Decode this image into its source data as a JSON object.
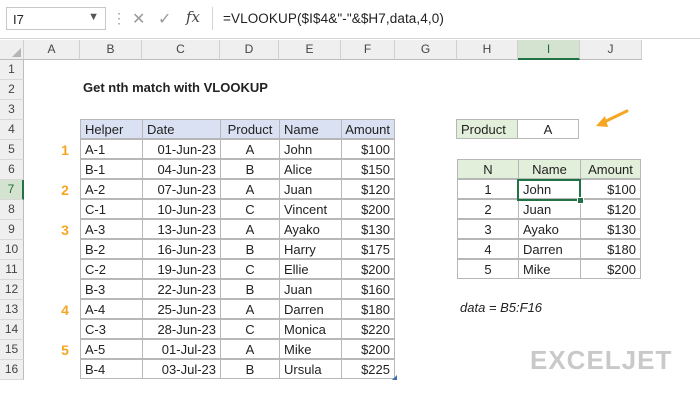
{
  "formula_bar": {
    "name_box": "I7",
    "name_box_icon": "chevron-down-icon",
    "fx_label": "fx",
    "formula": "=VLOOKUP($I$4&\"-\"&$H7,data,4,0)"
  },
  "columns": [
    "A",
    "B",
    "C",
    "D",
    "E",
    "F",
    "G",
    "H",
    "I",
    "J"
  ],
  "selected_column": "I",
  "rows": [
    "1",
    "2",
    "3",
    "4",
    "5",
    "6",
    "7",
    "8",
    "9",
    "10",
    "11",
    "12",
    "13",
    "14",
    "15",
    "16"
  ],
  "selected_row": "7",
  "title": "Get nth match with VLOOKUP",
  "data_table": {
    "headers": [
      "Helper",
      "Date",
      "Product",
      "Name",
      "Amount"
    ],
    "rows": [
      [
        "A-1",
        "01-Jun-23",
        "A",
        "John",
        "$100"
      ],
      [
        "B-1",
        "04-Jun-23",
        "B",
        "Alice",
        "$150"
      ],
      [
        "A-2",
        "07-Jun-23",
        "A",
        "Juan",
        "$120"
      ],
      [
        "C-1",
        "10-Jun-23",
        "C",
        "Vincent",
        "$200"
      ],
      [
        "A-3",
        "13-Jun-23",
        "A",
        "Ayako",
        "$130"
      ],
      [
        "B-2",
        "16-Jun-23",
        "B",
        "Harry",
        "$175"
      ],
      [
        "C-2",
        "19-Jun-23",
        "C",
        "Ellie",
        "$200"
      ],
      [
        "B-3",
        "22-Jun-23",
        "B",
        "Juan",
        "$160"
      ],
      [
        "A-4",
        "25-Jun-23",
        "A",
        "Darren",
        "$180"
      ],
      [
        "C-3",
        "28-Jun-23",
        "C",
        "Monica",
        "$220"
      ],
      [
        "A-5",
        "01-Jul-23",
        "A",
        "Mike",
        "$200"
      ],
      [
        "B-4",
        "03-Jul-23",
        "B",
        "Ursula",
        "$225"
      ]
    ]
  },
  "nth_markers": [
    {
      "label": "1",
      "row": 0
    },
    {
      "label": "2",
      "row": 2
    },
    {
      "label": "3",
      "row": 4
    },
    {
      "label": "4",
      "row": 8
    },
    {
      "label": "5",
      "row": 10
    }
  ],
  "product_input": {
    "label": "Product",
    "value": "A"
  },
  "results_table": {
    "headers": [
      "N",
      "Name",
      "Amount"
    ],
    "rows": [
      [
        "1",
        "John",
        "$100"
      ],
      [
        "2",
        "Juan",
        "$120"
      ],
      [
        "3",
        "Ayako",
        "$130"
      ],
      [
        "4",
        "Darren",
        "$180"
      ],
      [
        "5",
        "Mike",
        "$200"
      ]
    ]
  },
  "named_range_note": "data = B5:F16",
  "logo": "EXCELJET",
  "colors": {
    "header_blue": "#d9e1f2",
    "header_green": "#e2efda",
    "marker_orange": "#f5a623",
    "selection_green": "#217346"
  }
}
